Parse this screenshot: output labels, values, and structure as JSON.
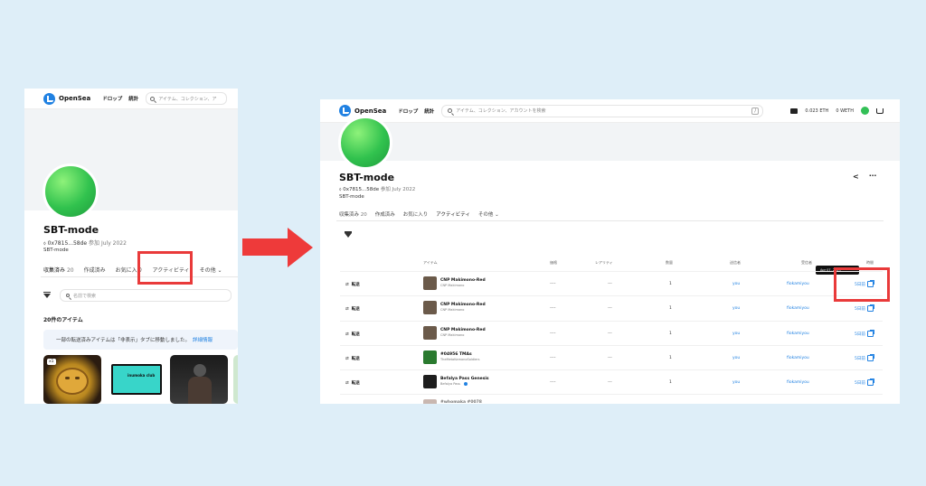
{
  "nav": {
    "brand": "OpenSea",
    "drops": "ドロップ",
    "stats": "統計",
    "search_placeholder_left": "アイテム、コレクション、ア",
    "search_placeholder_right": "アイテム、コレクション、アカウントを検索",
    "slash": "/",
    "eth_balance": "0.023 ETH",
    "weth_balance": "0 WETH"
  },
  "profile": {
    "name": "SBT-mode",
    "address": "0x7815...58de",
    "joined": "参加 July 2022",
    "bio": "SBT-mode"
  },
  "tabs": {
    "collected": "収集済み",
    "collected_count": "20",
    "created": "作成済み",
    "favorited": "お気に入り",
    "activity": "アクティビティ",
    "more": "その他"
  },
  "left": {
    "filter_search_placeholder": "名前で検索",
    "item_count": "20件のアイテム",
    "notice_text": "一部の転送済みアイテムは「非表示」タブに移動しました。",
    "notice_link": "詳細情報",
    "card1_badge": "x1",
    "card2_text": "inumoka club"
  },
  "table": {
    "headers": {
      "item": "アイテム",
      "price": "価格",
      "rarity": "レアリティ",
      "quantity": "数量",
      "from": "送信者",
      "to": "受信者",
      "time": "時間"
    },
    "tooltip": "Apr 07, 2023",
    "rows": [
      {
        "event": "転送",
        "name": "CNP Makimono-Red",
        "collection": "CNP Makimono",
        "price": "----",
        "rarity": "---",
        "qty": "1",
        "from": "you",
        "to": "fiokamiyou",
        "time": "5日前",
        "thumb_color": "#6b5a4a"
      },
      {
        "event": "転送",
        "name": "CNP Makimono-Red",
        "collection": "CNP Makimono",
        "price": "----",
        "rarity": "---",
        "qty": "1",
        "from": "you",
        "to": "fiokamiyou",
        "time": "5日前",
        "thumb_color": "#6b5a4a"
      },
      {
        "event": "転送",
        "name": "CNP Makimono-Red",
        "collection": "CNP Makimono",
        "price": "----",
        "rarity": "---",
        "qty": "1",
        "from": "you",
        "to": "fiokamiyou",
        "time": "5日前",
        "thumb_color": "#6b5a4a"
      },
      {
        "event": "転送",
        "name": "#04956 TMAs",
        "collection": "TheMetaKamonoSoldiers",
        "price": "----",
        "rarity": "---",
        "qty": "1",
        "from": "you",
        "to": "fiokamiyou",
        "time": "5日前",
        "thumb_color": "#2a7a2f"
      },
      {
        "event": "転送",
        "name": "Befalya Pass Genesis",
        "collection": "Befalya Pass",
        "price": "----",
        "rarity": "---",
        "qty": "1",
        "from": "you",
        "to": "fiokamiyou",
        "time": "5日前",
        "thumb_color": "#1d1d1d"
      }
    ],
    "partial_row": "#whomaka #0078"
  }
}
